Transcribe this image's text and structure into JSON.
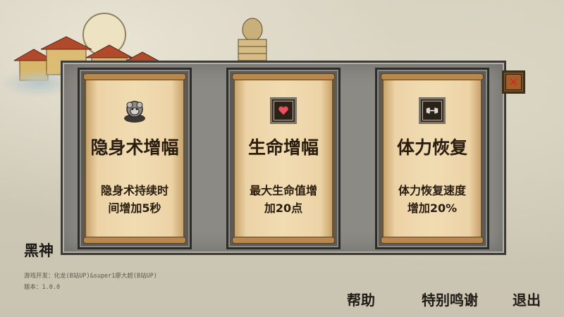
{
  "game": {
    "title": "黑神",
    "credits": "游戏开发：化龙(B站UP)&super1廖大超(B站UP)",
    "version": "版本：1.0.0"
  },
  "menu": {
    "help": "帮助",
    "thanks": "特别鸣谢",
    "exit": "退出"
  },
  "upgrades": [
    {
      "title": "隐身术增幅",
      "desc": "隐身术持续时间增加5秒",
      "icon": "monkey-stone-icon"
    },
    {
      "title": "生命增幅",
      "desc": "最大生命值增加20点",
      "icon": "heart-icon"
    },
    {
      "title": "体力恢复",
      "desc": "体力恢复速度增加20%",
      "icon": "dumbbell-icon"
    }
  ],
  "close_symbol": "✕",
  "colors": {
    "close_x": "#d8261c",
    "heart": "#e8535f"
  }
}
